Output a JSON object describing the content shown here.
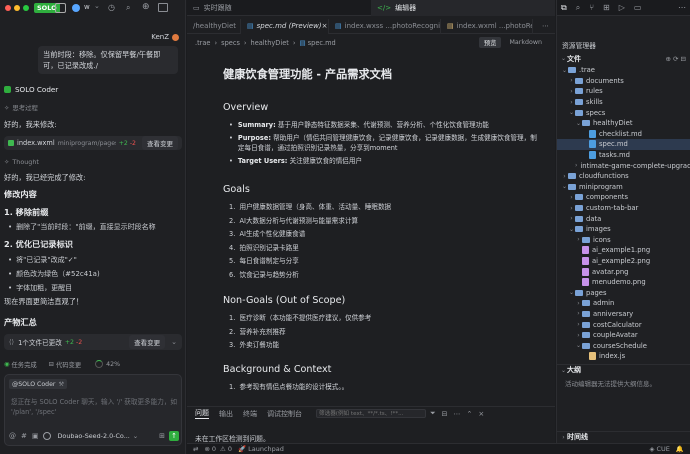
{
  "left": {
    "app_brand": "SOLO",
    "app_short": "w",
    "user_name": "KenZ",
    "user_message": "当前时段：移除。仅保留早餐/午餐即可，已记录改成./",
    "agent_name": "SOLO Coder",
    "thinking_label": "思考过程",
    "reply_intro": "好的，我来修改:",
    "file_chip": {
      "name": "index.wxml",
      "path": "miniprogram/pages/heal...",
      "added": "+2",
      "removed": "-2",
      "action": "查看变更"
    },
    "thought_label": "Thought",
    "reply_done": "好的，我已经完成了修改:",
    "section_title": "修改内容",
    "sub1_title": "1. 移除前缀",
    "sub1_items": [
      "删除了\"当前时段：\"前缀，直接显示时段名称"
    ],
    "sub2_title": "2. 优化已记录标识",
    "sub2_items": [
      "将\"已记录\"改成\"✓\"",
      "颜色改为绿色（#52c41a)",
      "字体加粗，更醒目"
    ],
    "final_note": "现在界面更简洁直观了！",
    "summary_title": "产物汇总",
    "summary_chip": {
      "text": "1个文件已更改",
      "added": "+2",
      "removed": "-2",
      "action": "查看变更"
    },
    "task_done": "任务完成",
    "code_changes": "代码变更",
    "progress_text": "42%",
    "progress_value": 42,
    "mention": "@SOLO Coder",
    "input_placeholder": "您正在与 SOLO Coder 聊天，输入 '/' 获取更多能力，如 '/plan', '/spec'",
    "model_name": "Doubao-Seed-2.0-Co..."
  },
  "center": {
    "tabs": [
      {
        "label": "实时跟随",
        "active": false
      },
      {
        "label": "编辑器",
        "active": true
      }
    ],
    "file_tabs": [
      {
        "label": "/healthyDiet",
        "active": false
      },
      {
        "label": "spec.md (Preview)",
        "active": true
      },
      {
        "label": "index.wxss ...photoRecognition",
        "active": false
      },
      {
        "label": "index.wxml ...photoReco...",
        "active": false
      }
    ],
    "breadcrumb": [
      ".trae",
      "specs",
      "healthyDiet",
      "spec.md"
    ],
    "preview_btn": "预览",
    "markdown_btn": "Markdown",
    "doc": {
      "title": "健康饮食管理功能 - 产品需求文档",
      "overview_h": "Overview",
      "overview": [
        {
          "k": "Summary:",
          "v": "基于用户静态特征数据采集、代谢预测、营养分析、个性化饮食管理功能"
        },
        {
          "k": "Purpose:",
          "v": "帮助用户（情侣共同管理健康饮食，记录健康饮食，记录健康数据，生成健康饮食管理，制定每日食谱，通过拍照识别记录热量，分享到moment"
        },
        {
          "k": "Target Users:",
          "v": "关注健康饮食的情侣用户"
        }
      ],
      "goals_h": "Goals",
      "goals": [
        "用户健康数据管理（身高、体重、活动量、睡眠数据",
        "AI大数据分析与代谢预测与能量需求计算",
        "AI生成个性化健康食谱",
        "拍照识别记录卡路里",
        "每日食谱制定与分享",
        "饮食记录与趋势分析"
      ],
      "nongoals_h": "Non-Goals (Out of Scope)",
      "nongoals": [
        "医疗诊断（本功能不提供医疗建议，仅供参考",
        "营养补充剂推荐",
        "外卖订餐功能"
      ],
      "bg_h": "Background & Context",
      "bg": [
        "参考现有情侣点餐功能的设计模式。。"
      ]
    },
    "panel_tabs": [
      "问题",
      "输出",
      "终端",
      "调试控制台"
    ],
    "filter_placeholder": "筛选器(例如 text、**/*.ts、!**...",
    "no_problems": "未在工作区检测到问题。"
  },
  "right": {
    "explorer_title": "资源管理器",
    "files_label": "文件",
    "tree": [
      {
        "label": ".trae",
        "type": "folder",
        "depth": 0,
        "open": true
      },
      {
        "label": "documents",
        "type": "folder",
        "depth": 1,
        "open": false
      },
      {
        "label": "rules",
        "type": "folder",
        "depth": 1,
        "open": false
      },
      {
        "label": "skills",
        "type": "folder",
        "depth": 1,
        "open": false
      },
      {
        "label": "specs",
        "type": "folder",
        "depth": 1,
        "open": true
      },
      {
        "label": "healthyDiet",
        "type": "folder",
        "depth": 2,
        "open": true
      },
      {
        "label": "checklist.md",
        "type": "md",
        "depth": 3
      },
      {
        "label": "spec.md",
        "type": "md",
        "depth": 3,
        "selected": true
      },
      {
        "label": "tasks.md",
        "type": "md",
        "depth": 3
      },
      {
        "label": "intimate-game-complete-upgrade",
        "type": "folder",
        "depth": 2,
        "open": false
      },
      {
        "label": "cloudfunctions",
        "type": "folder",
        "depth": 0,
        "open": false
      },
      {
        "label": "miniprogram",
        "type": "folder",
        "depth": 0,
        "open": true
      },
      {
        "label": "components",
        "type": "folder",
        "depth": 1,
        "open": false
      },
      {
        "label": "custom-tab-bar",
        "type": "folder",
        "depth": 1,
        "open": false
      },
      {
        "label": "data",
        "type": "folder",
        "depth": 1,
        "open": false
      },
      {
        "label": "images",
        "type": "folder",
        "depth": 1,
        "open": true
      },
      {
        "label": "icons",
        "type": "folder",
        "depth": 2,
        "open": false
      },
      {
        "label": "ai_example1.png",
        "type": "png",
        "depth": 2
      },
      {
        "label": "ai_example2.png",
        "type": "png",
        "depth": 2
      },
      {
        "label": "avatar.png",
        "type": "png",
        "depth": 2
      },
      {
        "label": "menudemo.png",
        "type": "png",
        "depth": 2
      },
      {
        "label": "pages",
        "type": "folder",
        "depth": 1,
        "open": true
      },
      {
        "label": "admin",
        "type": "folder",
        "depth": 2,
        "open": false
      },
      {
        "label": "anniversary",
        "type": "folder",
        "depth": 2,
        "open": false
      },
      {
        "label": "costCalculator",
        "type": "folder",
        "depth": 2,
        "open": false
      },
      {
        "label": "coupleAvatar",
        "type": "folder",
        "depth": 2,
        "open": false
      },
      {
        "label": "courseSchedule",
        "type": "folder",
        "depth": 2,
        "open": true
      },
      {
        "label": "index.js",
        "type": "js",
        "depth": 3
      }
    ],
    "outline_title": "大纲",
    "outline_empty": "活动编辑器无法提供大纲信息。",
    "timeline_title": "时间线"
  },
  "status": {
    "errors": "0",
    "warnings": "0",
    "launchpad": "Launchpad",
    "cue": "CUE"
  },
  "colors": {
    "accent": "#3b82f6",
    "green": "#3fb950",
    "red": "#f0524f",
    "folder": "#7aa2d6",
    "md": "#4d9de0",
    "png": "#c792ea",
    "js": "#e5c07b"
  }
}
